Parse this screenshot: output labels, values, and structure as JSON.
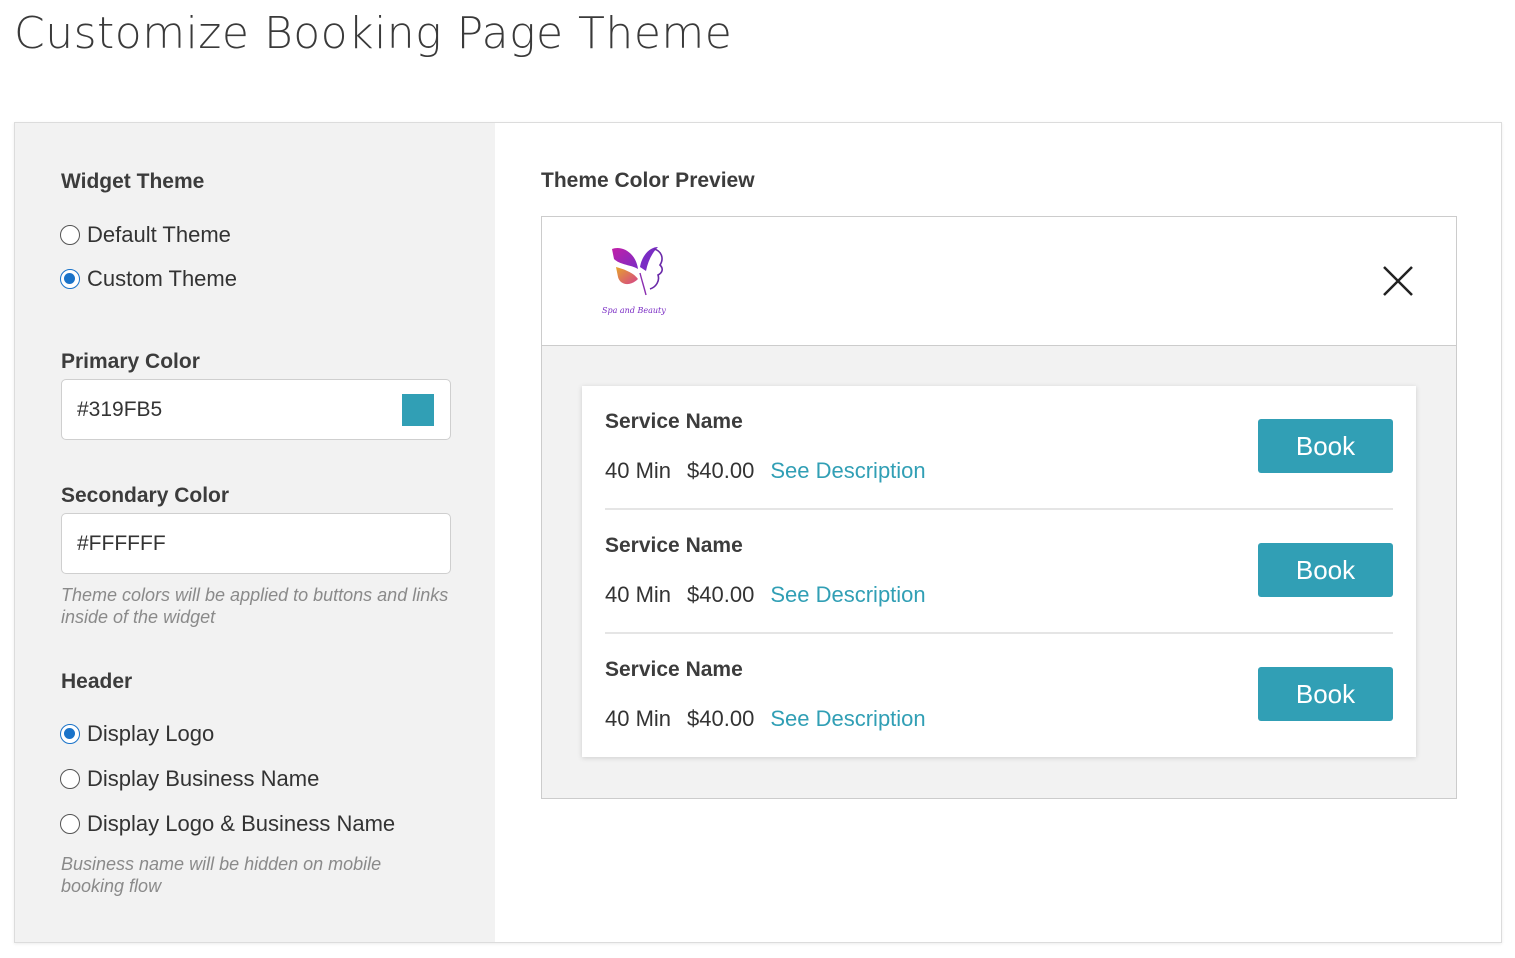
{
  "page": {
    "title": "Customize Booking Page Theme"
  },
  "settings": {
    "widget_theme": {
      "label": "Widget Theme",
      "options": [
        {
          "label": "Default Theme",
          "checked": false
        },
        {
          "label": "Custom Theme",
          "checked": true
        }
      ]
    },
    "primary_color": {
      "label": "Primary Color",
      "value": "#319FB5",
      "swatch": "#319fb5"
    },
    "secondary_color": {
      "label": "Secondary Color",
      "value": "#FFFFFF"
    },
    "colors_hint": "Theme colors will be applied to buttons and links inside of the widget",
    "header": {
      "label": "Header",
      "options": [
        {
          "label": "Display Logo",
          "checked": true
        },
        {
          "label": "Display Business Name",
          "checked": false
        },
        {
          "label": "Display Logo & Business Name",
          "checked": false
        }
      ]
    },
    "header_hint": "Business name will be hidden on mobile booking flow"
  },
  "preview": {
    "label": "Theme Color Preview",
    "logo_text": "Spa and Beauty",
    "services": [
      {
        "name": "Service Name",
        "duration": "40 Min",
        "price": "$40.00",
        "link": "See Description",
        "button": "Book"
      },
      {
        "name": "Service Name",
        "duration": "40 Min",
        "price": "$40.00",
        "link": "See Description",
        "button": "Book"
      },
      {
        "name": "Service Name",
        "duration": "40 Min",
        "price": "$40.00",
        "link": "See Description",
        "button": "Book"
      }
    ]
  },
  "colors": {
    "accent": "#319fb5",
    "radio_selected": "#1a73c9"
  }
}
